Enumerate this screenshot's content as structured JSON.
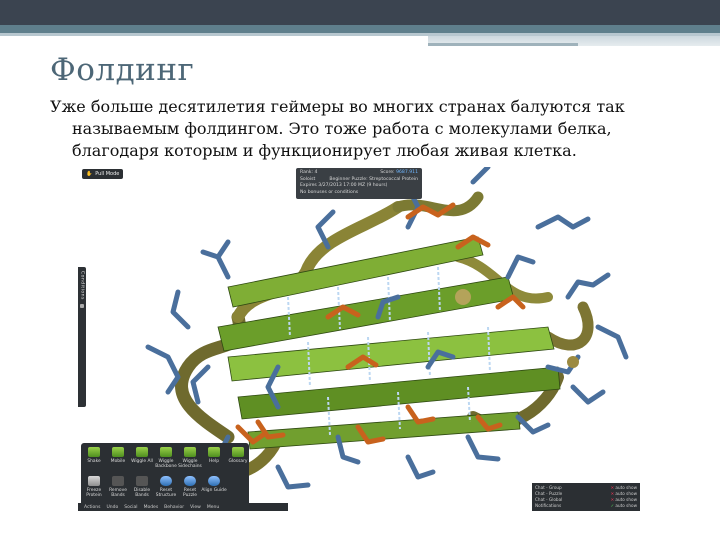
{
  "slide": {
    "title": "Фолдинг",
    "body": "Уже больше десятилетия геймеры во многих странах балуются так называемым фолдингом. Это тоже работа с молекулами белка, благодаря которым и функционирует любая живая клетка."
  },
  "game": {
    "pull_mode": "Pull Mode",
    "score_panel": {
      "rank_label": "Rank: 4",
      "score_label": "Score:",
      "score_value": "9687.911",
      "soloist": "Soloist",
      "puzzle": "Beginner Puzzle: Streptococcal Protein",
      "expires": "Expires 3/27/2013 17:00 MZ (9 hours)",
      "conditions": "No bonuses or conditions"
    },
    "side_label": "Conditions",
    "tools": [
      {
        "label": "Shake",
        "icon": "shake-icon",
        "color": "green"
      },
      {
        "label": "Mobile",
        "icon": "mobile-icon",
        "color": "green"
      },
      {
        "label": "Wiggle All",
        "icon": "wiggle-all-icon",
        "color": "green"
      },
      {
        "label": "Wiggle Backbone",
        "icon": "wiggle-backbone-icon",
        "color": "green"
      },
      {
        "label": "Wiggle Sidechains",
        "icon": "wiggle-sidechains-icon",
        "color": "green"
      },
      {
        "label": "Help",
        "icon": "help-icon",
        "color": "green"
      },
      {
        "label": "Glossary",
        "icon": "glossary-icon",
        "color": "green"
      },
      {
        "label": "Freeze Protein",
        "icon": "freeze-icon",
        "color": "gray"
      },
      {
        "label": "Remove Bands",
        "icon": "remove-bands-icon",
        "color": "dark"
      },
      {
        "label": "Disable Bands",
        "icon": "disable-bands-icon",
        "color": "dark"
      },
      {
        "label": "Reset Structure",
        "icon": "reset-structure-icon",
        "color": "blue"
      },
      {
        "label": "Reset Puzzle",
        "icon": "reset-puzzle-icon",
        "color": "blue"
      },
      {
        "label": "Align Guide",
        "icon": "align-guide-icon",
        "color": "blue"
      }
    ],
    "bottom_menu": [
      "Actions",
      "Undo",
      "Social",
      "Modes",
      "Behavior",
      "View",
      "Menu"
    ],
    "chat": [
      {
        "name": "Chat - Group",
        "toggle": "auto show"
      },
      {
        "name": "Chat - Puzzle",
        "toggle": "auto show"
      },
      {
        "name": "Chat - Global",
        "toggle": "auto show"
      },
      {
        "name": "Notifications",
        "toggle": "auto show"
      }
    ]
  }
}
